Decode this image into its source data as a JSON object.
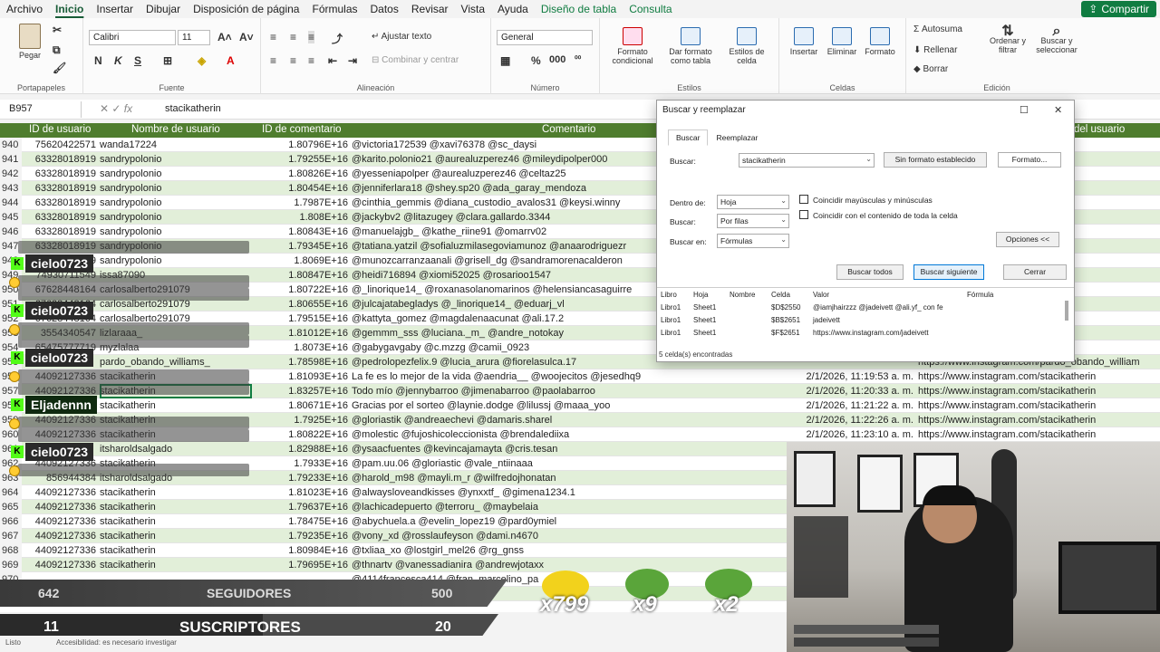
{
  "menu": {
    "tabs": [
      "Archivo",
      "Inicio",
      "Insertar",
      "Dibujar",
      "Disposición de página",
      "Fórmulas",
      "Datos",
      "Revisar",
      "Vista",
      "Ayuda",
      "Diseño de tabla",
      "Consulta"
    ],
    "active": "Inicio",
    "share": "Compartir"
  },
  "ribbon": {
    "portapapeles": {
      "pegar": "Pegar",
      "label": "Portapapeles"
    },
    "fuente": {
      "font": "Calibri",
      "size": "11",
      "label": "Fuente"
    },
    "alineacion": {
      "wrap": "Ajustar texto",
      "merge": "Combinar y centrar",
      "label": "Alineación"
    },
    "numero": {
      "format": "General",
      "label": "Número"
    },
    "estilos": {
      "cond": "Formato condicional",
      "table": "Dar formato como tabla",
      "cell": "Estilos de celda",
      "label": "Estilos"
    },
    "celdas": {
      "insert": "Insertar",
      "delete": "Eliminar",
      "format": "Formato",
      "label": "Celdas"
    },
    "edicion": {
      "autosum": "Autosuma",
      "fill": "Rellenar",
      "clear": "Borrar",
      "sort": "Ordenar y filtrar",
      "find": "Buscar y seleccionar",
      "label": "Edición"
    }
  },
  "formula_bar": {
    "namebox": "B957",
    "content": "stacikatherin"
  },
  "columns": [
    "ID de usuario",
    "Nombre de usuario",
    "ID de comentario",
    "Comentario",
    "",
    "del usuario"
  ],
  "rows": [
    {
      "n": "940",
      "id": "75620422571",
      "user": "wanda17224",
      "cid": "1.80796E+16",
      "text": "@victoria172539 @xavi76378 @sc_daysi",
      "date": "",
      "url": "del7224"
    },
    {
      "n": "941",
      "id": "63328018919",
      "user": "sandrypolonio",
      "cid": "1.79255E+16",
      "text": "@karito.polonio21 @aurealuzperez46 @mileydipolper000",
      "date": "",
      "url": ""
    },
    {
      "n": "942",
      "id": "63328018919",
      "user": "sandrypolonio",
      "cid": "1.80826E+16",
      "text": "@yesseniapolper @aurealuzperez46 @celtaz25",
      "date": "",
      "url": ""
    },
    {
      "n": "943",
      "id": "63328018919",
      "user": "sandrypolonio",
      "cid": "1.80454E+16",
      "text": "@jenniferlara18 @shey.sp20 @ada_garay_mendoza",
      "date": "",
      "url": ""
    },
    {
      "n": "944",
      "id": "63328018919",
      "user": "sandrypolonio",
      "cid": "1.7987E+16",
      "text": "@cinthia_gemmis @diana_custodio_avalos31 @keysi.winny",
      "date": "",
      "url": ""
    },
    {
      "n": "945",
      "id": "63328018919",
      "user": "sandrypolonio",
      "cid": "1.808E+16",
      "text": "@jackybv2 @litazugey @clara.gallardo.3344",
      "date": "",
      "url": ""
    },
    {
      "n": "946",
      "id": "63328018919",
      "user": "sandrypolonio",
      "cid": "1.80843E+16",
      "text": "@manuelajgb_ @kathe_riine91 @omarrv02",
      "date": "",
      "url": ""
    },
    {
      "n": "947",
      "id": "63328018919",
      "user": "sandrypolonio",
      "cid": "1.79345E+16",
      "text": "@tatiana.yatzil @sofialuzmilasegoviamunoz @anaarodriguezr",
      "date": "",
      "url": ""
    },
    {
      "n": "948",
      "id": "63328018919",
      "user": "sandrypolonio",
      "cid": "1.8069E+16",
      "text": "@munozcarranzaanali @grisell_dg @sandramorenacalderon",
      "date": "",
      "url": ""
    },
    {
      "n": "949",
      "id": "74930711549",
      "user": "issa87090",
      "cid": "1.80847E+16",
      "text": "@heidi716894 @xiomi52025 @rosarioo1547",
      "date": "",
      "url": "090"
    },
    {
      "n": "950",
      "id": "67628448164",
      "user": "carlosalberto291079",
      "cid": "1.80722E+16",
      "text": "@_linorique14_ @roxanasolanomarinos @helensiancasaguirre",
      "date": "",
      "url": "lberto291079"
    },
    {
      "n": "951",
      "id": "67628448164",
      "user": "carlosalberto291079",
      "cid": "1.80655E+16",
      "text": "@julcajatabegladys @_linorique14_ @eduarj_vl",
      "date": "",
      "url": "lberto291079"
    },
    {
      "n": "952",
      "id": "67628448164",
      "user": "carlosalberto291079",
      "cid": "1.79515E+16",
      "text": "@kattyta_gomez @magdalenaacunat @ali.17.2",
      "date": "",
      "url": "lberto291079"
    },
    {
      "n": "953",
      "id": "3554340547",
      "user": "lizlaraaa_",
      "cid": "1.81012E+16",
      "text": "@gemmm_sss @luciana._m_ @andre_notokay",
      "date": "",
      "url": "laa_"
    },
    {
      "n": "954",
      "id": "65475777719",
      "user": "myzlalaa",
      "cid": "1.8073E+16",
      "text": "@gabygavgaby @c.mzzg @camii_0923",
      "date": "",
      "url": ""
    },
    {
      "n": "955",
      "id": "",
      "user": "pardo_obando_williams_",
      "cid": "1.78598E+16",
      "text": "@pedrolopezfelix.9 @lucia_arura @fiorelasulca.17",
      "date": "",
      "url": "https://www.instagram.com/pardo_obando_william"
    },
    {
      "n": "956",
      "id": "44092127336",
      "user": "stacikatherin",
      "cid": "1.81093E+16",
      "text": "La fe es lo mejor de la vida   @aendria__ @woojecitos @jesedhq9",
      "date": "2/1/2026, 11:19:53 a. m.",
      "url": "https://www.instagram.com/stacikatherin"
    },
    {
      "n": "957",
      "id": "44092127336",
      "user": "stacikatherin",
      "cid": "1.83257E+16",
      "text": "Todo mío  @jennybarroo @jimenabarroo @paolabarroo",
      "date": "2/1/2026, 11:20:33 a. m.",
      "url": "https://www.instagram.com/stacikatherin"
    },
    {
      "n": "958",
      "id": "44092127336",
      "user": "stacikatherin",
      "cid": "1.80671E+16",
      "text": "Gracias por el sorteo  @laynie.dodge @lilussj @maaa_yoo",
      "date": "2/1/2026, 11:21:22 a. m.",
      "url": "https://www.instagram.com/stacikatherin"
    },
    {
      "n": "959",
      "id": "44092127336",
      "user": "stacikatherin",
      "cid": "1.7925E+16",
      "text": "@gloriastik @andreaechevi @damaris.sharel",
      "date": "2/1/2026, 11:22:26 a. m.",
      "url": "https://www.instagram.com/stacikatherin"
    },
    {
      "n": "960",
      "id": "44092127336",
      "user": "stacikatherin",
      "cid": "1.80822E+16",
      "text": "@molestic @fujoshicoleccionista @brendalediixa",
      "date": "2/1/2026, 11:23:10 a. m.",
      "url": "https://www.instagram.com/stacikatherin"
    },
    {
      "n": "961",
      "id": "",
      "user": "itsharoldsalgado",
      "cid": "1.82988E+16",
      "text": "@ysaacfuentes @kevincajamayta @cris.tesan",
      "date": "",
      "url": ""
    },
    {
      "n": "962",
      "id": "44092127336",
      "user": "stacikatherin",
      "cid": "1.7933E+16",
      "text": "@pam.uu.06 @gloriastic @vale_ntiinaaa",
      "date": "",
      "url": ""
    },
    {
      "n": "963",
      "id": "856944384",
      "user": "itsharoldsalgado",
      "cid": "1.79233E+16",
      "text": "@harold_m98 @mayli.m_r @wilfredojhonatan",
      "date": "",
      "url": ""
    },
    {
      "n": "964",
      "id": "44092127336",
      "user": "stacikatherin",
      "cid": "1.81023E+16",
      "text": "@alwaysloveandkisses @ynxxtf_ @gimena1234.1",
      "date": "",
      "url": ""
    },
    {
      "n": "965",
      "id": "44092127336",
      "user": "stacikatherin",
      "cid": "1.79637E+16",
      "text": "@lachicadepuerto @terroru_ @maybelaia",
      "date": "",
      "url": ""
    },
    {
      "n": "966",
      "id": "44092127336",
      "user": "stacikatherin",
      "cid": "1.78475E+16",
      "text": "@abychuela.a @evelin_lopez19 @pard0ymiel",
      "date": "",
      "url": ""
    },
    {
      "n": "967",
      "id": "44092127336",
      "user": "stacikatherin",
      "cid": "1.79235E+16",
      "text": "@vony_xd @rosslaufeyson @dami.n4670",
      "date": "",
      "url": ""
    },
    {
      "n": "968",
      "id": "44092127336",
      "user": "stacikatherin",
      "cid": "1.80984E+16",
      "text": "@txliaa_xo @lostgirl_mel26 @rg_gnss",
      "date": "",
      "url": ""
    },
    {
      "n": "969",
      "id": "44092127336",
      "user": "stacikatherin",
      "cid": "1.79695E+16",
      "text": "@thnartv @vanessadianira @andrewjotaxx",
      "date": "",
      "url": ""
    },
    {
      "n": "970",
      "id": "",
      "user": "",
      "cid": "",
      "text": "@4114francesca414 @fran_marcelino_pa",
      "date": "",
      "url": ""
    },
    {
      "n": "971",
      "id": "",
      "user": "",
      "cid": "",
      "text": "@ ... rdbiella @xm",
      "date": "",
      "url": ""
    }
  ],
  "chat": [
    {
      "user": "cielo0723",
      "badge": "K"
    },
    {
      "user": "cielo0723",
      "badge": "K"
    },
    {
      "user": "cielo0723",
      "badge": "K"
    },
    {
      "user": "Eljadennn",
      "badge": "K"
    },
    {
      "user": "cielo0723",
      "badge": "K"
    }
  ],
  "dialog": {
    "title": "Buscar y reemplazar",
    "tabs": [
      "Buscar",
      "Reemplazar"
    ],
    "find_label": "Buscar:",
    "find_value": "stacikatherin",
    "no_format": "Sin formato establecido",
    "format_btn": "Formato...",
    "within_label": "Dentro de:",
    "within_value": "Hoja",
    "search_label": "Buscar:",
    "search_value": "Por filas",
    "lookin_label": "Buscar en:",
    "lookin_value": "Fórmulas",
    "match_case": "Coincidir mayúsculas y minúsculas",
    "match_whole": "Coincidir con el contenido de toda la celda",
    "options_btn": "Opciones <<",
    "find_all": "Buscar todos",
    "find_next": "Buscar siguiente",
    "close": "Cerrar",
    "results_headers": [
      "Libro",
      "Hoja",
      "Nombre",
      "Celda",
      "Valor",
      "Fórmula"
    ],
    "results": [
      {
        "book": "Libro1",
        "sheet": "Sheet1",
        "cell": "$D$2550",
        "value": "@iamjhairzzz @jadeivett @ali.yf_ con fe"
      },
      {
        "book": "Libro1",
        "sheet": "Sheet1",
        "cell": "$B$2651",
        "value": "jadeivett"
      },
      {
        "book": "Libro1",
        "sheet": "Sheet1",
        "cell": "$F$2651",
        "value": "https://www.instagram.com/jadeivett"
      }
    ],
    "footer": "5 celda(s) encontradas"
  },
  "stream": {
    "followers_current": "642",
    "followers_label": "SEGUIDORES",
    "followers_goal": "500",
    "subs_current": "11",
    "subs_label": "SUSCRIPTORES",
    "subs_goal": "20",
    "emote1": "x799",
    "emote2": "x9",
    "emote3": "x2"
  },
  "statusbar": {
    "ready": "Listo",
    "access": "Accesibilidad: es necesario investigar"
  }
}
